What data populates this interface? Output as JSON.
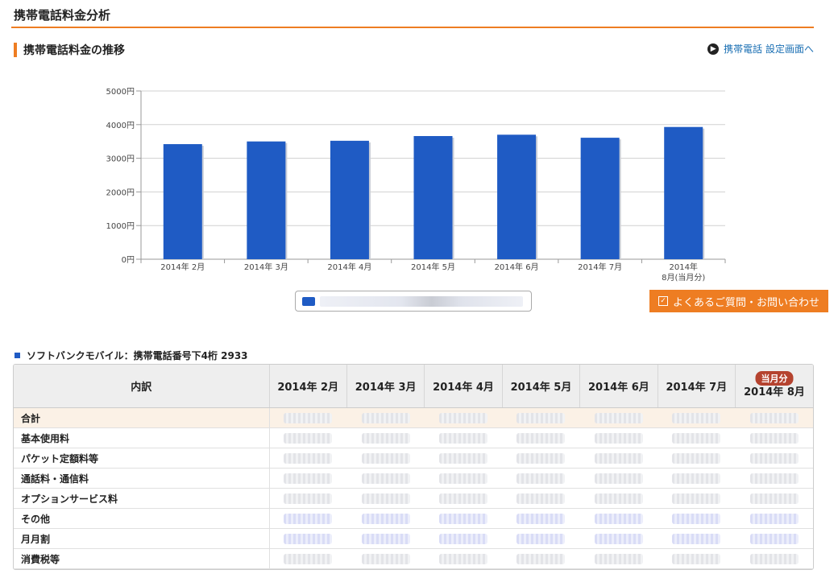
{
  "page": {
    "title": "携帯電話料金分析",
    "section_title": "携帯電話料金の推移",
    "settings_link": "携帯電話 設定画面へ",
    "faq_button": "よくあるご質問・お問い合わせ",
    "carrier_heading": "ソフトバンクモバイル：携帯電話番号下4桁 2933"
  },
  "colors": {
    "accent": "#ee7d22",
    "bar": "#1f5bc4",
    "link": "#1a6fb3",
    "badge": "#b5432f"
  },
  "chart_data": {
    "type": "bar",
    "categories": [
      "2014年 2月",
      "2014年 3月",
      "2014年 4月",
      "2014年 5月",
      "2014年 6月",
      "2014年 7月",
      "2014年\n8月(当月分)"
    ],
    "values": [
      3420,
      3500,
      3520,
      3660,
      3700,
      3610,
      3930
    ],
    "y_ticks": [
      "0円",
      "1000円",
      "2000円",
      "3000円",
      "4000円",
      "5000円"
    ],
    "ylim": [
      0,
      5000
    ],
    "grid": true,
    "legend": "bottom-center"
  },
  "table": {
    "header_label": "内訳",
    "columns": [
      "2014年 2月",
      "2014年 3月",
      "2014年 4月",
      "2014年 5月",
      "2014年 6月",
      "2014年 7月",
      "2014年 8月"
    ],
    "current_badge": "当月分",
    "rows": [
      {
        "label": "合計"
      },
      {
        "label": "基本使用料"
      },
      {
        "label": "パケット定額料等"
      },
      {
        "label": "通話料・通信料"
      },
      {
        "label": "オプションサービス料"
      },
      {
        "label": "その他"
      },
      {
        "label": "月月割"
      },
      {
        "label": "消費税等"
      }
    ]
  }
}
